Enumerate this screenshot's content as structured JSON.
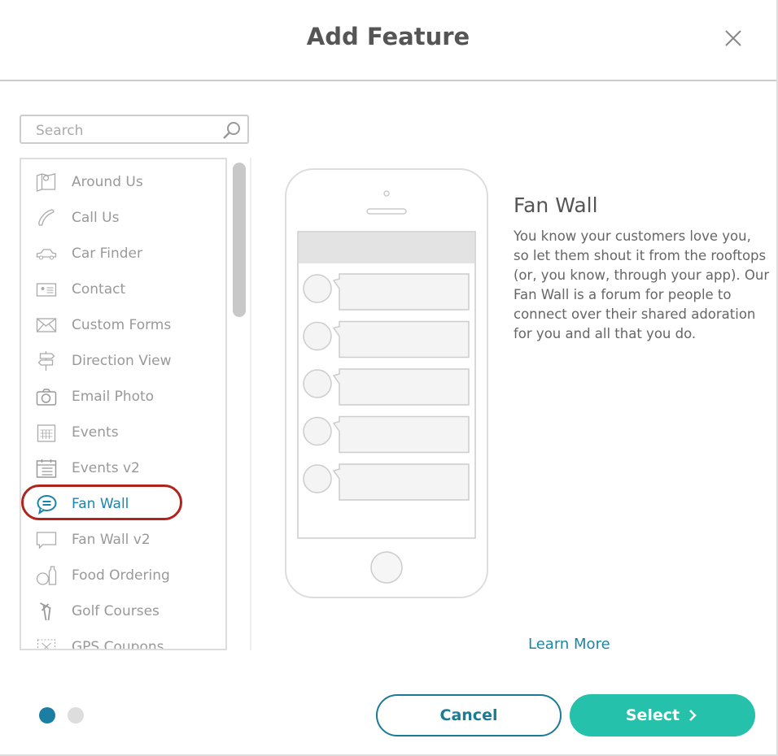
{
  "dialog": {
    "title": "Add Feature",
    "close_icon": "close-icon"
  },
  "search": {
    "placeholder": "Search",
    "value": "",
    "icon": "search-icon"
  },
  "features": [
    {
      "label": "Around Us",
      "icon": "map-pin-icon"
    },
    {
      "label": "Call Us",
      "icon": "phone-icon"
    },
    {
      "label": "Car Finder",
      "icon": "car-icon"
    },
    {
      "label": "Contact",
      "icon": "contact-card-icon"
    },
    {
      "label": "Custom Forms",
      "icon": "envelope-icon"
    },
    {
      "label": "Direction View",
      "icon": "signpost-icon"
    },
    {
      "label": "Email Photo",
      "icon": "camera-icon"
    },
    {
      "label": "Events",
      "icon": "calendar-icon"
    },
    {
      "label": "Events v2",
      "icon": "calendar-list-icon"
    },
    {
      "label": "Fan Wall",
      "icon": "chat-bubble-icon",
      "selected": true
    },
    {
      "label": "Fan Wall v2",
      "icon": "speech-bubble-icon"
    },
    {
      "label": "Food Ordering",
      "icon": "food-icon"
    },
    {
      "label": "Golf Courses",
      "icon": "golf-icon"
    },
    {
      "label": "GPS Coupons",
      "icon": "coupon-icon"
    }
  ],
  "preview": {
    "title": "Fan Wall",
    "description": "You know your customers love you, so let them shout it from the rooftops (or, you know, through your app). Our Fan Wall is a forum for people to connect over their shared adoration for you and all that you do.",
    "learn_more": "Learn More"
  },
  "pagination": {
    "current": 1,
    "total": 2
  },
  "buttons": {
    "cancel": "Cancel",
    "select": "Select"
  },
  "colors": {
    "accent": "#1a85a8",
    "select": "#25c1aa",
    "highlight_ring": "#b0241e"
  }
}
